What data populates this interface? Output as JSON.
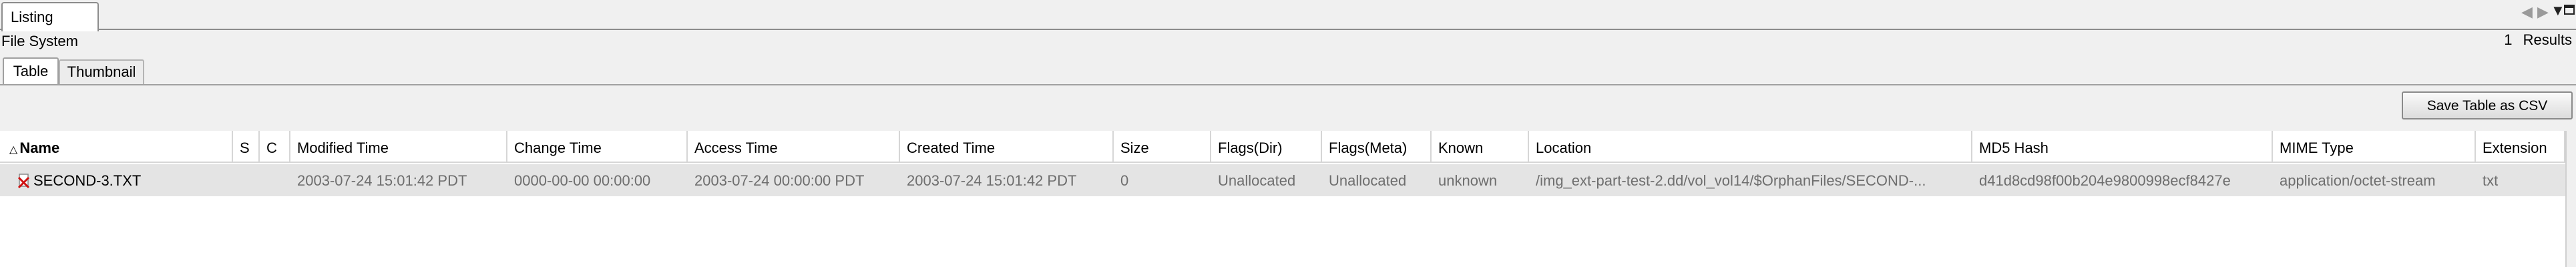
{
  "listing_tab": {
    "label": "Listing"
  },
  "file_system_label": "File System",
  "results_count": "1 Results",
  "view_tabs": {
    "table": "Table",
    "thumbnail": "Thumbnail"
  },
  "save_button_label": "Save Table as CSV",
  "columns": {
    "name": "Name",
    "s": "S",
    "c": "C",
    "modified": "Modified Time",
    "change": "Change Time",
    "access": "Access Time",
    "created": "Created Time",
    "size": "Size",
    "flags_dir": "Flags(Dir)",
    "flags_meta": "Flags(Meta)",
    "known": "Known",
    "location": "Location",
    "md5": "MD5 Hash",
    "mime": "MIME Type",
    "extension": "Extension"
  },
  "rows": [
    {
      "name": "SECOND-3.TXT",
      "s": "",
      "c": "",
      "modified": "2003-07-24 15:01:42 PDT",
      "change": "0000-00-00 00:00:00",
      "access": "2003-07-24 00:00:00 PDT",
      "created": "2003-07-24 15:01:42 PDT",
      "size": "0",
      "flags_dir": "Unallocated",
      "flags_meta": "Unallocated",
      "known": "unknown",
      "location": "/img_ext-part-test-2.dd/vol_vol14/$OrphanFiles/SECOND-...",
      "md5": "d41d8cd98f00b204e9800998ecf8427e",
      "mime": "application/octet-stream",
      "extension": "txt"
    }
  ],
  "icons": {
    "tab_left": "triangle-left-icon",
    "tab_right": "triangle-right-icon",
    "tab_list": "triangle-down-icon",
    "maximize": "maximize-icon",
    "sort": "sort-ascending-icon",
    "deleted_file": "deleted-file-icon"
  }
}
